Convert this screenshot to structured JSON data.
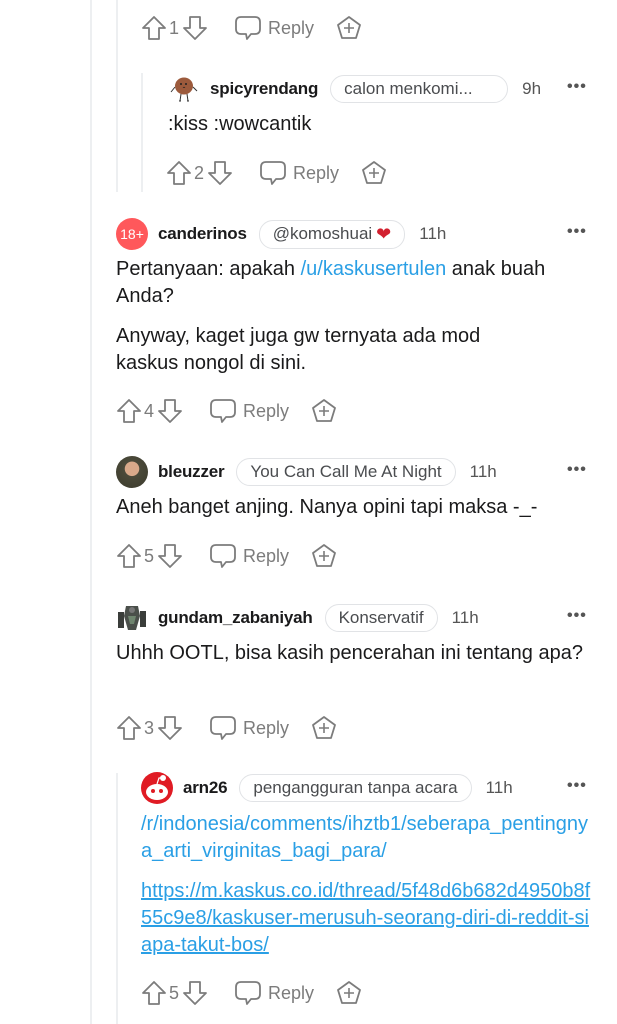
{
  "colors": {
    "link": "#2a9fe5",
    "thread_line": "#edeff1",
    "action_gray": "#7c7c7c",
    "nsfw_badge": "#ff585b"
  },
  "top_actions": {
    "score": "1",
    "reply_label": "Reply"
  },
  "comments": [
    {
      "username": "spicyrendang",
      "flair": "calon menkomi...",
      "time": "9h",
      "avatar_icon": "potato-character-avatar",
      "body": [
        ":kiss :wowcantik"
      ],
      "score": "2",
      "reply_label": "Reply"
    },
    {
      "username": "canderinos",
      "flair": "@komoshuai",
      "flair_emoji": "❤",
      "time": "11h",
      "avatar_icon": "nsfw-18-avatar",
      "avatar_text": "18+",
      "body_line1_before": "Pertanyaan: apakah ",
      "body_line1_link": "/u/kaskusertulen",
      "body_line1_after": " anak buah Anda?",
      "body_p2": "Anyway, kaget juga gw ternyata ada mod kaskus nongol di sini.",
      "score": "4",
      "reply_label": "Reply"
    },
    {
      "username": "bleuzzer",
      "flair": "You Can Call Me At Night",
      "time": "11h",
      "avatar_icon": "photo-avatar",
      "body": [
        "Aneh banget anjing. Nanya opini tapi maksa -_-"
      ],
      "score": "5",
      "reply_label": "Reply"
    },
    {
      "username": "gundam_zabaniyah",
      "flair": "Konservatif",
      "time": "11h",
      "avatar_icon": "gundam-avatar",
      "body": [
        "Uhhh OOTL, bisa kasih pencerahan ini tentang apa?"
      ],
      "score": "3",
      "reply_label": "Reply"
    },
    {
      "username": "arn26",
      "flair": "pengangguran tanpa acara",
      "time": "11h",
      "avatar_icon": "snoo-avatar",
      "link1": "/r/indonesia/comments/ihztb1/seberapa_pentingnya_arti_virginitas_bagi_para/",
      "link2": "https://m.kaskus.co.id/thread/5f48d6b682d4950b8f55c9e8/kaskuser-merusuh-seorang-diri-di-reddit-siapa-takut-bos/",
      "score": "5",
      "reply_label": "Reply"
    }
  ]
}
